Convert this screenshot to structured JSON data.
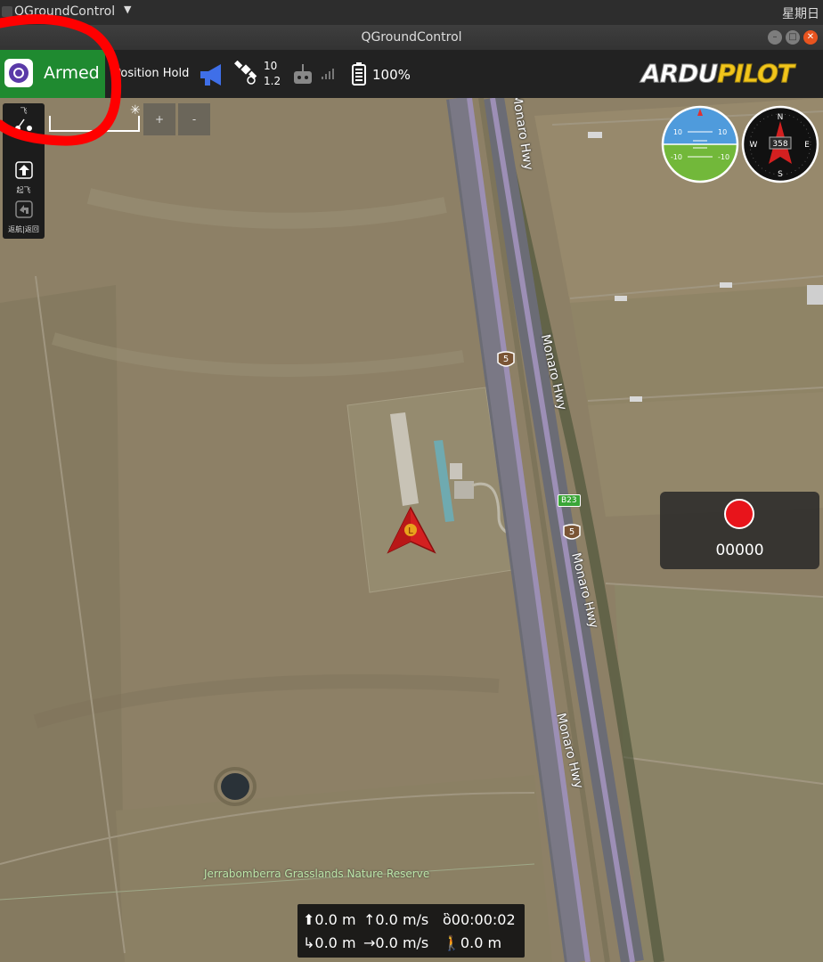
{
  "os_bar": {
    "app_title": "QGroundControl",
    "clock": "星期日"
  },
  "window": {
    "title": "QGroundControl"
  },
  "toolbar": {
    "armed_status": "Armed",
    "flight_mode": "Position Hold",
    "gps": {
      "satellites": "10",
      "hdop": "1.2"
    },
    "battery": "100%",
    "logo": "ARDUPILOT"
  },
  "tool_strip": {
    "plan_label": "飞",
    "takeoff_label": "起飞",
    "rtl_label": "返航|返回"
  },
  "map": {
    "road_labels": [
      "Monaro Hwy",
      "Monaro Hwy",
      "Monaro Hwy",
      "Monaro Hwy"
    ],
    "shields": [
      "5",
      "5"
    ],
    "route_badge": "B23",
    "reserve_label": "Jerrabomberra Grasslands Nature Reserve",
    "zoom_in": "+",
    "zoom_out": "-",
    "vehicle_marker": "L"
  },
  "instruments": {
    "attitude_marks": [
      "10",
      "10",
      "-10",
      "-10"
    ],
    "heading": "358",
    "compass_points": [
      "N",
      "E",
      "S",
      "W"
    ]
  },
  "recorder": {
    "timer": "00000"
  },
  "telemetry": {
    "altitude": "0.0 m",
    "vertical_speed": "0.0 m/s",
    "flight_time": "00:00:02",
    "distance": "0.0 m",
    "ground_speed": "0.0 m/s",
    "home_distance": "0.0 m"
  },
  "colors": {
    "armed": "#1f8a30",
    "record": "#e8141b",
    "annotation": "#ff0000"
  },
  "icons": [
    "megaphone-icon",
    "satellite-icon",
    "rc-icon",
    "signal-icon",
    "battery-icon"
  ]
}
